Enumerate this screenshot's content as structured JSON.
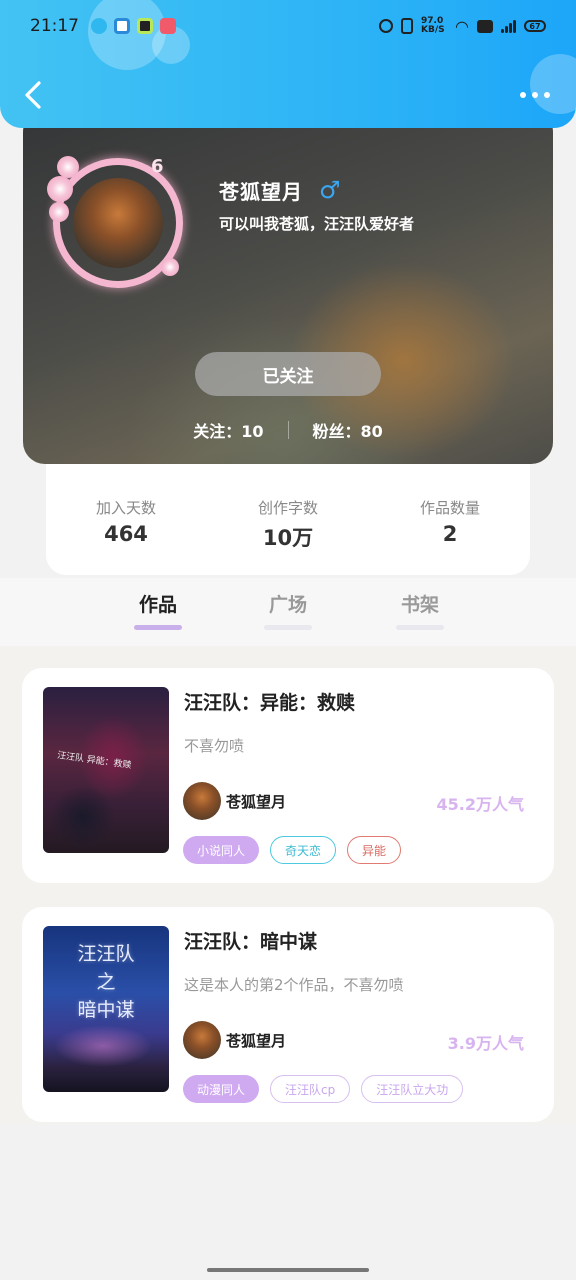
{
  "status_bar": {
    "time": "21:17",
    "network_speed": "97.0 KB/S",
    "battery": "67",
    "icons": [
      "chat-app-icon",
      "browser-icon",
      "circle-app-icon",
      "music-app-icon",
      "alarm-icon",
      "vibrate-icon",
      "wifi-icon",
      "hd-icon",
      "5g-signal-icon",
      "battery-icon"
    ]
  },
  "header": {
    "back_icon": "chevron-left-icon",
    "more_icon": "more-dots-icon",
    "gradient": [
      "#43c3f3",
      "#1da6f8"
    ]
  },
  "profile": {
    "level": "6",
    "name": "苍狐望月",
    "gender_symbol": "♂",
    "bio": "可以叫我苍狐，汪汪队爱好者",
    "follow_button": "已关注",
    "following_label": "关注：",
    "following_value": "10",
    "fans_label": "粉丝：",
    "fans_value": "80"
  },
  "stats": [
    {
      "label": "加入天数",
      "value": "464"
    },
    {
      "label": "创作字数",
      "value": "10万"
    },
    {
      "label": "作品数量",
      "value": "2"
    }
  ],
  "tabs": [
    {
      "label": "作品",
      "active": true
    },
    {
      "label": "广场",
      "active": false
    },
    {
      "label": "书架",
      "active": false
    }
  ],
  "works": [
    {
      "title": "汪汪队：异能：救赎",
      "description": "不喜勿喷",
      "cover_text": "汪汪队 异能：救赎",
      "author": "苍狐望月",
      "popularity": "45.2万人气",
      "tags": [
        {
          "label": "小说同人",
          "style": "filled",
          "color": "#cfaaf0"
        },
        {
          "label": "奇天恋",
          "style": "outline",
          "color": "#4cc9de"
        },
        {
          "label": "异能",
          "style": "outline",
          "color": "#e07a72"
        }
      ]
    },
    {
      "title": "汪汪队：暗中谋",
      "description": "这是本人的第2个作品，不喜勿喷",
      "cover_lines": [
        "汪汪队",
        "之",
        "暗中谋"
      ],
      "author": "苍狐望月",
      "popularity": "3.9万人气",
      "tags": [
        {
          "label": "动漫同人",
          "style": "filled",
          "color": "#cfaaf0"
        },
        {
          "label": "汪汪队cp",
          "style": "outline",
          "color": "#cfaaf0"
        },
        {
          "label": "汪汪队立大功",
          "style": "outline",
          "color": "#cfaaf0"
        }
      ]
    }
  ]
}
